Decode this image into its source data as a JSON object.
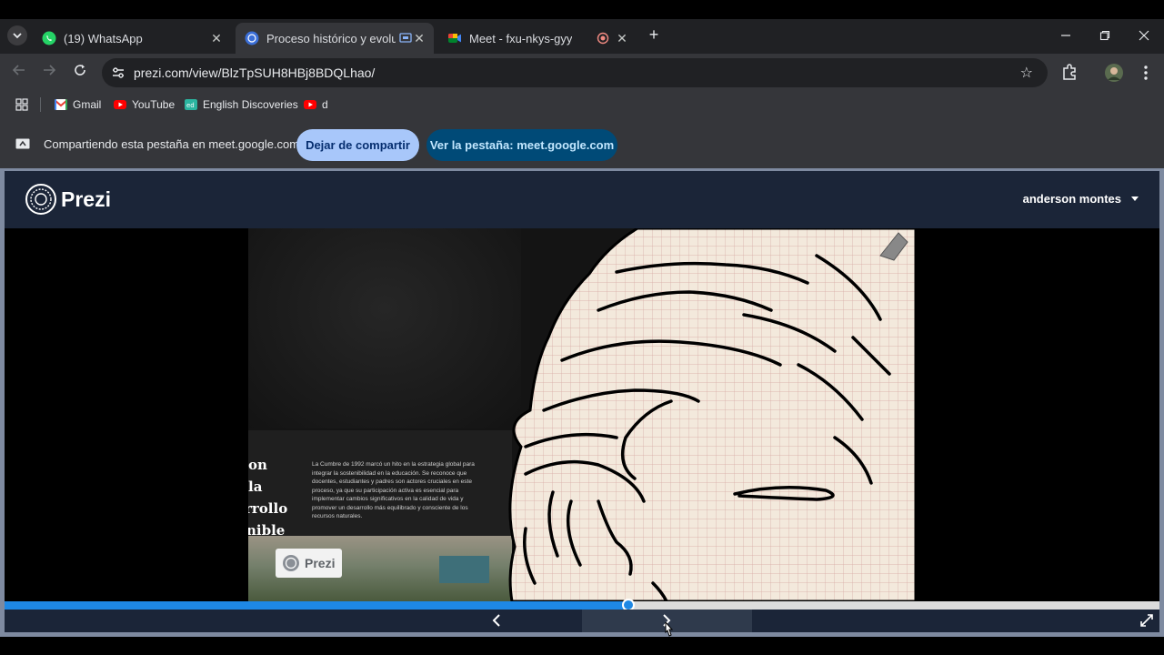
{
  "browser": {
    "tabs": [
      {
        "label": "(19) WhatsApp",
        "icon": "whatsapp-icon",
        "active": false
      },
      {
        "label": "Proceso histórico y evolució",
        "icon": "prezi-icon",
        "active": true
      },
      {
        "label": "Meet - fxu-nkys-gyy",
        "icon": "meet-icon",
        "active": false
      }
    ],
    "new_tab": "+",
    "url": "prezi.com/view/BlzTpSUH8HBj8BDQLhao/",
    "bookmarks": [
      "Gmail",
      "YouTube",
      "English Discoveries",
      "d"
    ],
    "share_bar": {
      "text": "Compartiendo esta pestaña en meet.google.com",
      "stop_label": "Dejar de compartir",
      "view_label": "Ver la pestaña: meet.google.com"
    }
  },
  "prezi": {
    "logo_text": "Prezi",
    "user_name": "anderson montes",
    "slide": {
      "title_lines": [
        "on la",
        "rrollo",
        "nible"
      ],
      "paragraph": "La Cumbre de 1992 marcó un hito en la estrategia global para integrar la sostenibilidad en la educación. Se reconoce que docentes, estudiantes y padres son actores cruciales en este proceso, ya que su participación activa es esencial para implementar cambios significativos en la calidad de vida y promover un desarrollo más equilibrado y consciente de los recursos naturales.",
      "badge_text": "Prezi"
    },
    "progress_fraction": 0.54,
    "colors": {
      "header_bg": "#1b2538",
      "progress": "#1e88e5",
      "share_stop_bg": "#a8c7fa",
      "share_view_bg": "#004a77"
    }
  }
}
